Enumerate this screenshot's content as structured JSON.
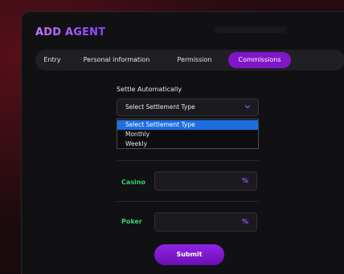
{
  "modal": {
    "title": "ADD AGENT"
  },
  "tabs": [
    {
      "label": "Entry",
      "active": false
    },
    {
      "label": "Personal information",
      "active": false
    },
    {
      "label": "Permission",
      "active": false
    },
    {
      "label": "Commissions",
      "active": true
    }
  ],
  "settle": {
    "label": "Settle Automatically",
    "selected_value": "Select Settlement Type",
    "options": [
      {
        "label": "Select Settlement Type",
        "highlighted": true
      },
      {
        "label": "Monthly",
        "highlighted": false
      },
      {
        "label": "Weekly",
        "highlighted": false
      }
    ]
  },
  "commissions": [
    {
      "label": "Casino",
      "value": "",
      "unit": "%"
    },
    {
      "label": "Poker",
      "value": "",
      "unit": "%"
    }
  ],
  "submit_label": "Submit",
  "colors": {
    "accent": "#8116c9",
    "highlight": "#1d6fe0",
    "row_label": "#37d36b",
    "percent": "#a054ff"
  },
  "icons": {
    "select_arrow": "chevron-down-icon"
  }
}
